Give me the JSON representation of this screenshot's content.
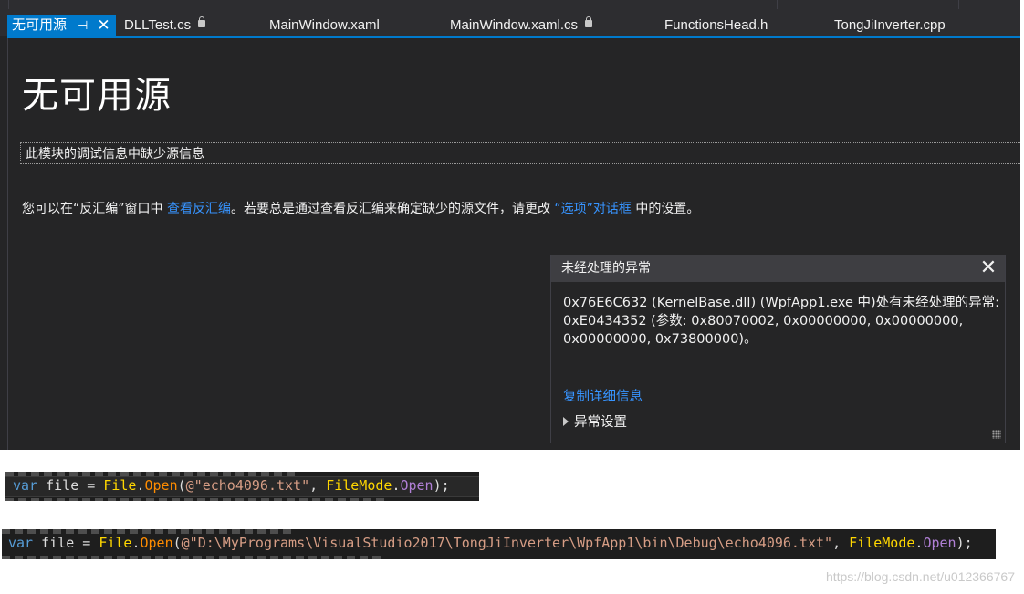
{
  "tabs": [
    {
      "label": "无可用源",
      "active": true
    },
    {
      "label": "DLLTest.cs",
      "locked": true
    },
    {
      "label": "MainWindow.xaml"
    },
    {
      "label": "MainWindow.xaml.cs",
      "locked": true
    },
    {
      "label": "FunctionsHead.h"
    },
    {
      "label": "TongJiInverter.cpp"
    }
  ],
  "icons": {
    "pin": "pin-icon",
    "close": "close-icon",
    "lock": "lock-icon",
    "expand": "triangle-right-icon",
    "grip": "resize-grip-icon"
  },
  "page": {
    "title": "无可用源",
    "info": "此模块的调试信息中缺少源信息",
    "hint_prefix": "您可以在“反汇编”窗口中 ",
    "hint_link1": "查看反汇编",
    "hint_middle": "。若要总是通过查看反汇编来确定缺少的源文件，请更改 ",
    "hint_link2": "“选项”对话框",
    "hint_suffix": " 中的设置。"
  },
  "exception": {
    "title": "未经处理的异常",
    "message": "0x76E6C632 (KernelBase.dll) (WpfApp1.exe 中)处有未经处理的异常: 0xE0434352 (参数: 0x80070002, 0x00000000, 0x00000000, 0x00000000, 0x73800000)。",
    "copy_link": "复制详细信息",
    "settings_label": "异常设置"
  },
  "code": {
    "snippet1": {
      "kw": "var",
      "ident": " file = ",
      "type": "File",
      "dot1": ".",
      "method": "Open",
      "open_paren": "(",
      "string": "@\"echo4096.txt\"",
      "comma": ", ",
      "enum_type": "FileMode",
      "dot2": ".",
      "enum_value": "Open",
      "end": ");"
    },
    "snippet2": {
      "kw": "var",
      "ident": " file = ",
      "type": "File",
      "dot1": ".",
      "method": "Open",
      "open_paren": "(",
      "string": "@\"D:\\MyPrograms\\VisualStudio2017\\TongJiInverter\\WpfApp1\\bin\\Debug\\echo4096.txt\"",
      "comma": ", ",
      "enum_type": "FileMode",
      "dot2": ".",
      "enum_value": "Open",
      "end": ");"
    }
  },
  "colors": {
    "accent": "#007acc",
    "link": "#3794ff",
    "keyword": "#569cd6",
    "type": "#ffd700",
    "method": "#ff8c00",
    "string": "#d69d85",
    "enum_member": "#b180d7"
  },
  "watermark": "https://blog.csdn.net/u012366767"
}
